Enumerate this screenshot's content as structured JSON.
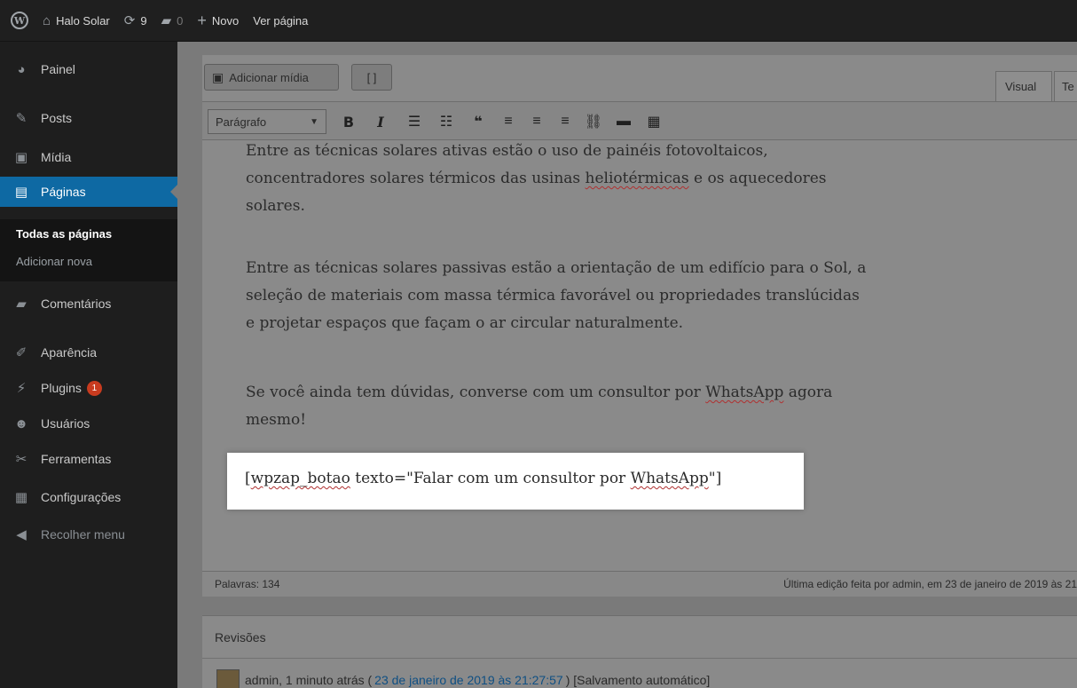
{
  "adminbar": {
    "site_name": "Halo Solar",
    "updates_count": "9",
    "comments_count": "0",
    "new_label": "Novo",
    "view_page_label": "Ver página"
  },
  "sidebar": {
    "items": [
      {
        "label": "Painel",
        "icon": "dashboard-icon"
      },
      {
        "label": "Posts",
        "icon": "pin-icon"
      },
      {
        "label": "Mídia",
        "icon": "media-icon"
      },
      {
        "label": "Páginas",
        "icon": "pages-icon"
      },
      {
        "label": "Comentários",
        "icon": "comment-icon"
      },
      {
        "label": "Aparência",
        "icon": "brush-icon"
      },
      {
        "label": "Plugins",
        "icon": "plugin-icon",
        "badge": "1"
      },
      {
        "label": "Usuários",
        "icon": "users-icon"
      },
      {
        "label": "Ferramentas",
        "icon": "wrench-icon"
      },
      {
        "label": "Configurações",
        "icon": "settings-icon"
      },
      {
        "label": "Recolher menu",
        "icon": "collapse-icon"
      }
    ],
    "submenu": {
      "all_pages": "Todas as páginas",
      "add_new": "Adicionar nova"
    }
  },
  "editor": {
    "add_media_label": "Adicionar mídia",
    "shortcode_button_label": "[ ]",
    "tab_visual": "Visual",
    "tab_text": "Te",
    "format_select": "Parágrafo",
    "paragraphs": {
      "p1_line1": "Entre as técnicas solares ativas estão o uso de painéis fotovoltaicos,",
      "p1_line2a": "concentradores solares térmicos das usinas ",
      "p1_line2_u": "heliotérmicas",
      "p1_line2b": " e os aquecedores",
      "p1_line3": "solares.",
      "p2_line1": "Entre as técnicas solares passivas estão a orientação de um edifício para o Sol, a",
      "p2_line2": "seleção de materiais com massa térmica favorável ou propriedades translúcidas",
      "p2_line3": "e projetar espaços que façam o ar circular naturalmente.",
      "p3_line1a": "Se você ainda tem dúvidas, converse com um consultor por ",
      "p3_line1_u": "WhatsApp",
      "p3_line1b": " agora",
      "p3_line2": "mesmo!"
    },
    "shortcode": {
      "open": "[",
      "tag": "wpzap_botao",
      "attr": " texto=\"Falar com um consultor por ",
      "word": "WhatsApp",
      "close": "\"]"
    },
    "word_count": "Palavras: 134",
    "last_edit": "Última edição feita por admin, em 23 de janeiro de 2019 às 21"
  },
  "revisions": {
    "title": "Revisões",
    "entry_prefix": "admin, 1 minuto atrás (",
    "entry_link": "23 de janeiro de 2019 às 21:27:57",
    "entry_suffix": ") [Salvamento automático]"
  }
}
